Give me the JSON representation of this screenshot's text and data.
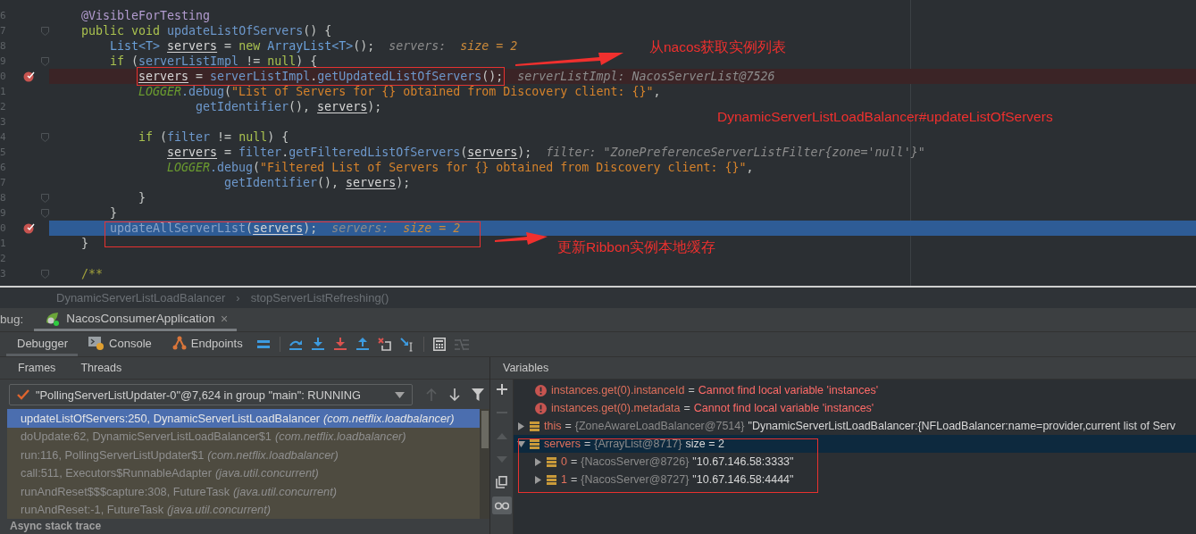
{
  "code_lines": [
    {
      "num": "6",
      "tokens": [
        {
          "t": "@VisibleForTesting",
          "kind": "ann"
        }
      ],
      "kind": "plain",
      "breakpoint": false,
      "fold": false,
      "continuation": false
    },
    {
      "num": "7",
      "tokens": [
        {
          "t": "public void ",
          "kind": "kw"
        },
        {
          "t": "updateListOfServers",
          "kind": "method"
        },
        {
          "t": "() {",
          "kind": "punct"
        }
      ],
      "kind": "plain",
      "breakpoint": false,
      "fold": true,
      "continuation": false,
      "children": [
        {
          "num": "8",
          "tokens": [
            {
              "t": "List<T> ",
              "kind": "type"
            },
            {
              "t": "servers",
              "kind": "local"
            },
            {
              "t": " = ",
              "kind": "punct"
            },
            {
              "t": "new ",
              "kind": "kw"
            },
            {
              "t": "ArrayList<T>",
              "kind": "type"
            },
            {
              "t": "();",
              "kind": "punct"
            }
          ],
          "hints": [
            {
              "t": "servers:  ",
              "kind": "hint"
            },
            {
              "t": "size = 2",
              "kind": "value"
            }
          ],
          "kind": "plain",
          "breakpoint": false,
          "fold": false,
          "continuation": false
        },
        {
          "num": "9",
          "tokens": [
            {
              "t": "if ",
              "kind": "kw"
            },
            {
              "t": "(",
              "kind": "punct"
            },
            {
              "t": "serverListImpl",
              "kind": "field"
            },
            {
              "t": " != ",
              "kind": "punct"
            },
            {
              "t": "null",
              "kind": "kw"
            },
            {
              "t": ") {",
              "kind": "punct"
            }
          ],
          "kind": "plain",
          "breakpoint": false,
          "fold": true,
          "continuation": false,
          "children": [
            {
              "num": "0",
              "tokens": [
                {
                  "t": "servers",
                  "kind": "local"
                },
                {
                  "t": " = ",
                  "kind": "punct"
                },
                {
                  "t": "serverListImpl",
                  "kind": "field"
                },
                {
                  "t": ".",
                  "kind": "punct"
                },
                {
                  "t": "getUpdatedListOfServers",
                  "kind": "method"
                },
                {
                  "t": "();",
                  "kind": "punct"
                }
              ],
              "hints": [
                {
                  "t": "serverListImpl: NacosServerList@7526",
                  "kind": "hint"
                }
              ],
              "kind": "breakpoint",
              "framed": true,
              "breakpoint": true,
              "fold": false,
              "continuation": false
            },
            {
              "num": "1",
              "tokens": [
                {
                  "t": "LOGGER",
                  "kind": "static"
                },
                {
                  "t": ".debug",
                  "kind": "method"
                },
                {
                  "t": "(",
                  "kind": "punct"
                },
                {
                  "t": "\"List of Servers for {} obtained from Discovery client: {}\"",
                  "kind": "str"
                },
                {
                  "t": ",",
                  "kind": "punct"
                }
              ],
              "kind": "plain",
              "breakpoint": false,
              "fold": false,
              "continuation": false,
              "children": [
                {
                  "num": "2",
                  "tokens": [
                    {
                      "t": "getIdentifier",
                      "kind": "method"
                    },
                    {
                      "t": "(), ",
                      "kind": "punct"
                    },
                    {
                      "t": "servers",
                      "kind": "local"
                    },
                    {
                      "t": ");",
                      "kind": "punct"
                    }
                  ],
                  "kind": "plain",
                  "breakpoint": false,
                  "fold": false,
                  "continuation": true
                }
              ]
            },
            {
              "num": "3",
              "kind": "plain",
              "breakpoint": false,
              "fold": false
            },
            {
              "num": "4",
              "tokens": [
                {
                  "t": "if ",
                  "kind": "kw"
                },
                {
                  "t": "(",
                  "kind": "punct"
                },
                {
                  "t": "filter",
                  "kind": "field"
                },
                {
                  "t": " != ",
                  "kind": "punct"
                },
                {
                  "t": "null",
                  "kind": "kw"
                },
                {
                  "t": ") {",
                  "kind": "punct"
                }
              ],
              "kind": "plain",
              "breakpoint": false,
              "fold": true,
              "continuation": false,
              "children": [
                {
                  "num": "5",
                  "tokens": [
                    {
                      "t": "servers",
                      "kind": "local"
                    },
                    {
                      "t": " = ",
                      "kind": "punct"
                    },
                    {
                      "t": "filter",
                      "kind": "field"
                    },
                    {
                      "t": ".",
                      "kind": "punct"
                    },
                    {
                      "t": "getFilteredListOfServers",
                      "kind": "method"
                    },
                    {
                      "t": "(",
                      "kind": "punct"
                    },
                    {
                      "t": "servers",
                      "kind": "local"
                    },
                    {
                      "t": ");",
                      "kind": "punct"
                    }
                  ],
                  "hints": [
                    {
                      "t": "filter: \"ZonePreferenceServerListFilter{zone='null'}\"",
                      "kind": "hint"
                    }
                  ],
                  "kind": "plain",
                  "breakpoint": false,
                  "fold": false,
                  "continuation": false
                },
                {
                  "num": "6",
                  "tokens": [
                    {
                      "t": "LOGGER",
                      "kind": "static"
                    },
                    {
                      "t": ".debug",
                      "kind": "method"
                    },
                    {
                      "t": "(",
                      "kind": "punct"
                    },
                    {
                      "t": "\"Filtered List of Servers for {} obtained from Discovery client: {}\"",
                      "kind": "str"
                    },
                    {
                      "t": ",",
                      "kind": "punct"
                    }
                  ],
                  "kind": "plain",
                  "breakpoint": false,
                  "fold": false,
                  "continuation": false,
                  "children": [
                    {
                      "num": "7",
                      "tokens": [
                        {
                          "t": "getIdentifier",
                          "kind": "method"
                        },
                        {
                          "t": "(), ",
                          "kind": "punct"
                        },
                        {
                          "t": "servers",
                          "kind": "local"
                        },
                        {
                          "t": ");",
                          "kind": "punct"
                        }
                      ],
                      "kind": "plain",
                      "breakpoint": false,
                      "fold": false,
                      "continuation": true
                    }
                  ]
                }
              ]
            },
            {
              "num": "8",
              "tokens": [
                {
                  "t": "}",
                  "kind": "punct"
                }
              ],
              "kind": "plain",
              "breakpoint": false,
              "fold": true,
              "continuation": false
            }
          ]
        },
        {
          "num": "9",
          "tokens": [
            {
              "t": "}",
              "kind": "punct"
            }
          ],
          "kind": "plain",
          "breakpoint": false,
          "fold": true,
          "continuation": false
        },
        {
          "num": "0",
          "tokens": [
            {
              "t": "updateAllServerList",
              "kind": "method"
            },
            {
              "t": "(",
              "kind": "punct"
            },
            {
              "t": "servers",
              "kind": "local"
            },
            {
              "t": ");",
              "kind": "punct"
            }
          ],
          "hints": [
            {
              "t": "servers:  ",
              "kind": "hint"
            },
            {
              "t": "size = 2",
              "kind": "value"
            }
          ],
          "kind": "execution",
          "breakpoint": true,
          "fold": false,
          "continuation": false
        }
      ]
    },
    {
      "num": "1",
      "tokens": [
        {
          "t": "}",
          "kind": "punct"
        }
      ],
      "kind": "plain",
      "breakpoint": false,
      "fold": false,
      "continuation": false
    },
    {
      "num": "2",
      "kind": "plain",
      "breakpoint": false,
      "fold": false
    },
    {
      "num": "3",
      "tokens": [
        {
          "t": "/**",
          "kind": "comment"
        }
      ],
      "kind": "plain",
      "breakpoint": false,
      "fold": true,
      "continuation": false
    }
  ],
  "callouts": [
    "从nacos获取实例列表",
    "DynamicServerListLoadBalancer#updateListOfServers",
    "更新Ribbon实例本地缓存"
  ],
  "breadcrumb": {
    "items": [
      "DynamicServerListLoadBalancer",
      "stopServerListRefreshing()"
    ],
    "separator": "›"
  },
  "debug_bar": {
    "label": "bug:",
    "session": "NacosConsumerApplication",
    "close": "×"
  },
  "toolbar": {
    "tabs": [
      {
        "label": "Debugger",
        "kind": "debugger",
        "selected": true
      },
      {
        "label": "Console",
        "kind": "console",
        "selected": false
      },
      {
        "label": "Endpoints",
        "kind": "endpoints",
        "selected": false
      }
    ],
    "actions": [
      {
        "kind": "layout",
        "disabled": false
      },
      {
        "kind": "step-over",
        "disabled": false
      },
      {
        "kind": "step-into",
        "disabled": false
      },
      {
        "kind": "force-step-into",
        "disabled": false
      },
      {
        "kind": "step-out",
        "disabled": false
      },
      {
        "kind": "drop-frame",
        "disabled": false
      },
      {
        "kind": "run-to-cursor",
        "disabled": false
      },
      {
        "kind": "evaluate",
        "disabled": false
      },
      {
        "kind": "trace",
        "disabled": true
      }
    ]
  },
  "frames_panel": {
    "tabs": [
      "Frames",
      "Threads"
    ],
    "thread": "\"PollingServerListUpdater-0\"@7,624 in group \"main\": RUNNING",
    "nav": [
      {
        "kind": "up",
        "disabled": true
      },
      {
        "kind": "down",
        "disabled": false
      },
      {
        "kind": "filter",
        "disabled": false
      }
    ],
    "frames": [
      {
        "method": "updateListOfServers:250, DynamicServerListLoadBalancer",
        "package": "(com.netflix.loadbalancer)",
        "selected": true
      },
      {
        "method": "doUpdate:62, DynamicServerListLoadBalancer$1",
        "package": "(com.netflix.loadbalancer)",
        "selected": false
      },
      {
        "method": "run:116, PollingServerListUpdater$1",
        "package": "(com.netflix.loadbalancer)",
        "selected": false
      },
      {
        "method": "call:511, Executors$RunnableAdapter",
        "package": "(java.util.concurrent)",
        "selected": false
      },
      {
        "method": "runAndReset$$$capture:308, FutureTask",
        "package": "(java.util.concurrent)",
        "selected": false
      },
      {
        "method": "runAndReset:-1, FutureTask",
        "package": "(java.util.concurrent)",
        "selected": false
      }
    ],
    "async_label": "Async stack trace"
  },
  "variables_panel": {
    "title": "Variables",
    "tools": [
      {
        "kind": "add",
        "disabled": false,
        "selected": false
      },
      {
        "kind": "remove",
        "disabled": true,
        "selected": false
      },
      {
        "kind": "up",
        "disabled": true,
        "selected": false
      },
      {
        "kind": "down",
        "disabled": true,
        "selected": false
      },
      {
        "kind": "copy",
        "disabled": false,
        "selected": false
      },
      {
        "kind": "watches",
        "disabled": false,
        "selected": true
      }
    ],
    "variables": [
      {
        "kind": "error",
        "name": "instances.get(0).instanceId",
        "op": "=",
        "value": "Cannot find local variable 'instances'"
      },
      {
        "kind": "error",
        "name": "instances.get(0).metadata",
        "op": "=",
        "value": "Cannot find local variable 'instances'"
      },
      {
        "kind": "field",
        "name": "this",
        "op": "=",
        "ref": "{ZoneAwareLoadBalancer@7514}",
        "value": "\"DynamicServerListLoadBalancer:{NFLoadBalancer:name=provider,current list of Serv",
        "expanded": false,
        "selected": false
      },
      {
        "kind": "field",
        "name": "servers",
        "op": "=",
        "ref": "{ArrayList@8717}",
        "value": "size = 2",
        "expanded": true,
        "selected": true,
        "children": [
          {
            "kind": "field",
            "name": "0",
            "op": "=",
            "ref": "{NacosServer@8726}",
            "value": "\"10.67.146.58:3333\"",
            "expanded": false,
            "selected": false
          },
          {
            "kind": "field",
            "name": "1",
            "op": "=",
            "ref": "{NacosServer@8727}",
            "value": "\"10.67.146.58:4444\"",
            "expanded": false,
            "selected": false
          }
        ]
      }
    ]
  }
}
